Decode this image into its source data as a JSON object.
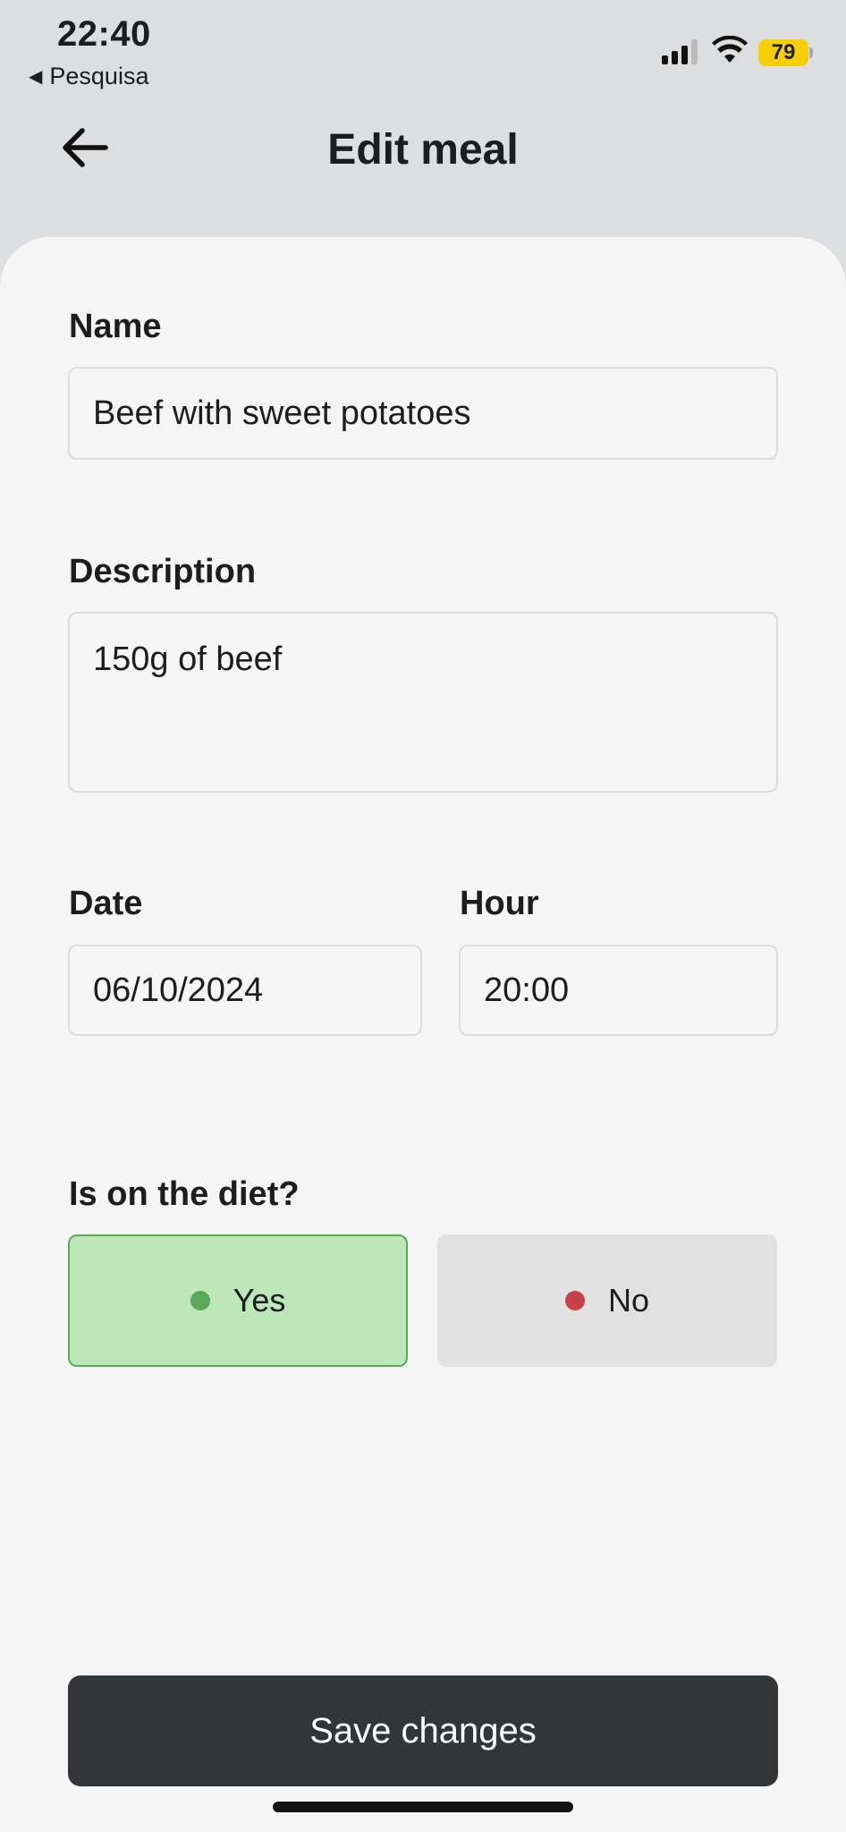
{
  "status": {
    "time": "22:40",
    "back_app": "Pesquisa",
    "battery": "79"
  },
  "header": {
    "title": "Edit meal"
  },
  "form": {
    "name_label": "Name",
    "name_value": "Beef with sweet potatoes",
    "description_label": "Description",
    "description_value": "150g of beef",
    "date_label": "Date",
    "date_value": "06/10/2024",
    "hour_label": "Hour",
    "hour_value": "20:00",
    "diet_label": "Is on the diet?",
    "yes_label": "Yes",
    "no_label": "No",
    "selected": "yes"
  },
  "colors": {
    "yes_dot": "#5aa85a",
    "no_dot": "#c9404a"
  },
  "actions": {
    "save_label": "Save changes"
  }
}
